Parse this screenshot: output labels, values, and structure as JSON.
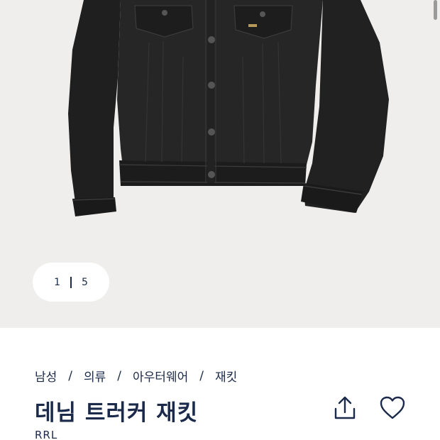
{
  "gallery": {
    "counter": {
      "current": "1",
      "total": "5"
    }
  },
  "breadcrumb": [
    "남성",
    "의류",
    "아우터웨어",
    "재킷"
  ],
  "product": {
    "title": "데님 트러커 재킷",
    "brand": "RRL"
  },
  "icons": {
    "share": "share-icon",
    "wishlist": "heart-icon"
  }
}
